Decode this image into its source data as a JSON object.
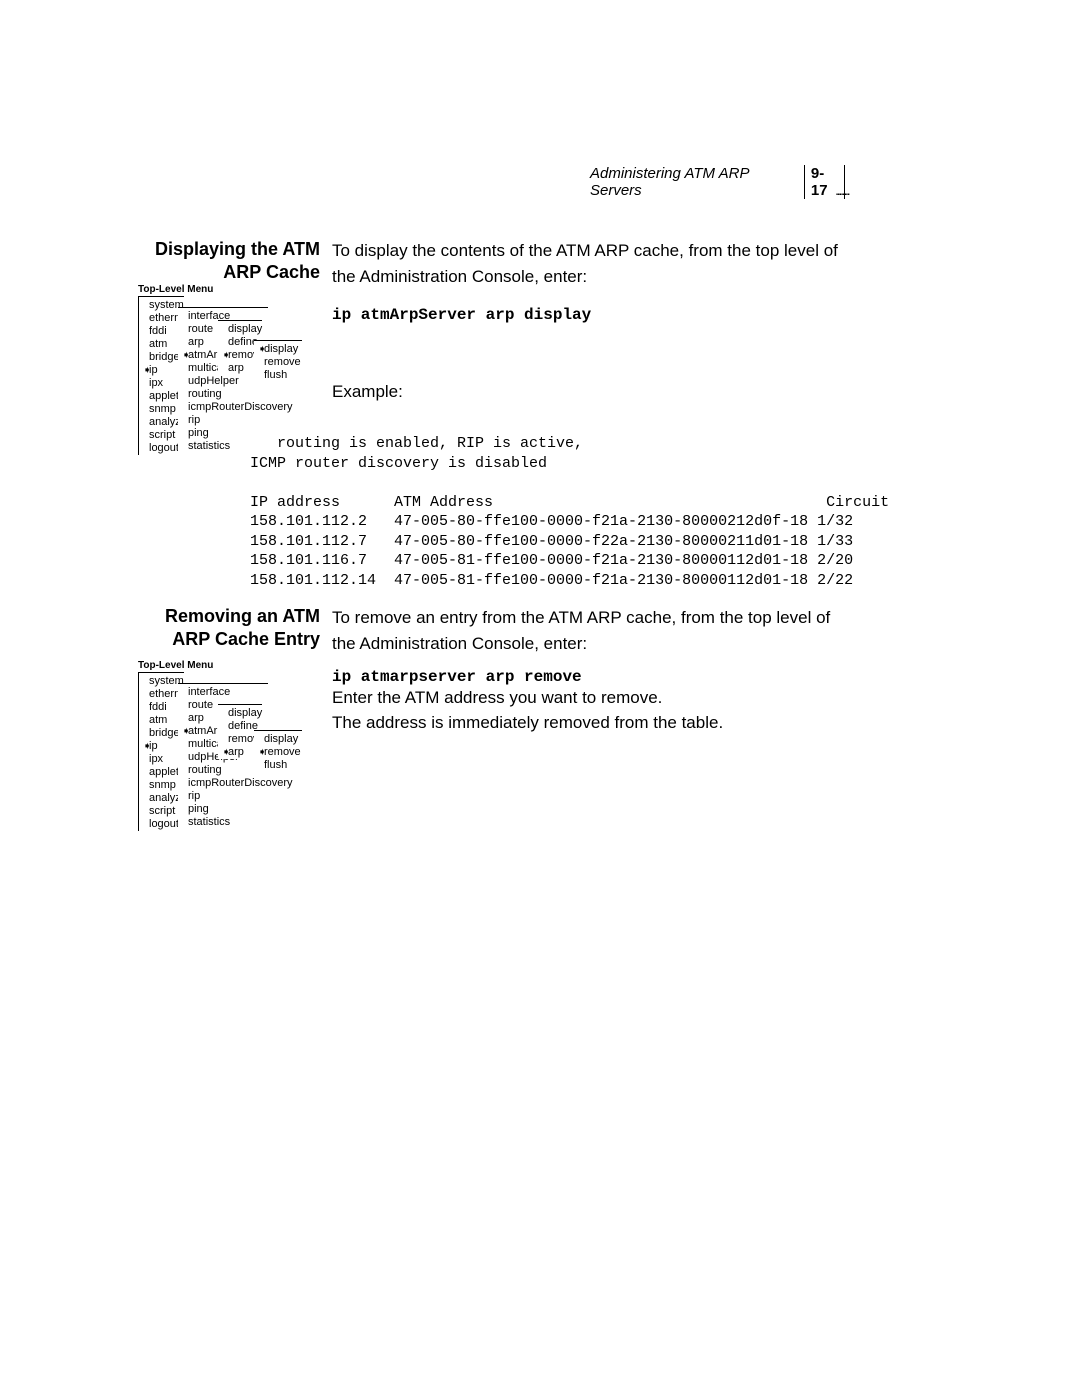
{
  "header": {
    "title": "Administering ATM ARP Servers",
    "page": "9-17",
    "dots": "········"
  },
  "section1": {
    "heading": "Displaying the ATM ARP Cache",
    "intro": "To display the contents of the ATM ARP cache, from the top level of the Administration Console, enter:",
    "cmd": "ip atmArpServer arp display",
    "example_label": "Example:",
    "output": "IP routing is enabled, RIP is active,\nICMP router discovery is disabled\n\nIP address      ATM Address                                     Circuit\n158.101.112.2   47-005-80-ffe100-0000-f21a-2130-80000212d0f-18 1/32\n158.101.112.7   47-005-80-ffe100-0000-f22a-2130-80000211d01-18 1/33\n158.101.116.7   47-005-81-ffe100-0000-f21a-2130-80000112d01-18 2/20\n158.101.112.14  47-005-81-ffe100-0000-f21a-2130-80000112d01-18 2/22"
  },
  "section2": {
    "heading": "Removing an ATM ARP Cache Entry",
    "intro": "To remove an entry from the ATM ARP cache, from the top level of the Administration Console, enter:",
    "cmd": "ip atmarpserver arp remove",
    "para2": "Enter the ATM address you want to remove.",
    "para3": "The address is immediately removed from the table."
  },
  "menu_title": "Top-Level Menu",
  "menu_col0": [
    "system",
    "ethernet",
    "fddi",
    "atm",
    "bridge",
    "ip",
    "ipx",
    "appletalk",
    "snmp",
    "analyzer",
    "script",
    "logout"
  ],
  "menu_col1": [
    "interface",
    "route",
    "arp",
    "atmArpS",
    "multicast",
    "udpHelper",
    "routing",
    "icmpRouterDiscovery",
    "rip",
    "ping",
    "statistics"
  ],
  "menu_col2": [
    "display",
    "define",
    "remove",
    "arp"
  ],
  "menu_col3": [
    "display",
    "remove",
    "flush"
  ],
  "menu_col0_marked": 5,
  "menu_col1_marked": 3,
  "menu_col2_marked_a": 2,
  "menu_col2_marked_b": 3,
  "menu_col3_marked_a": 0,
  "menu_col3_marked_b": 1
}
